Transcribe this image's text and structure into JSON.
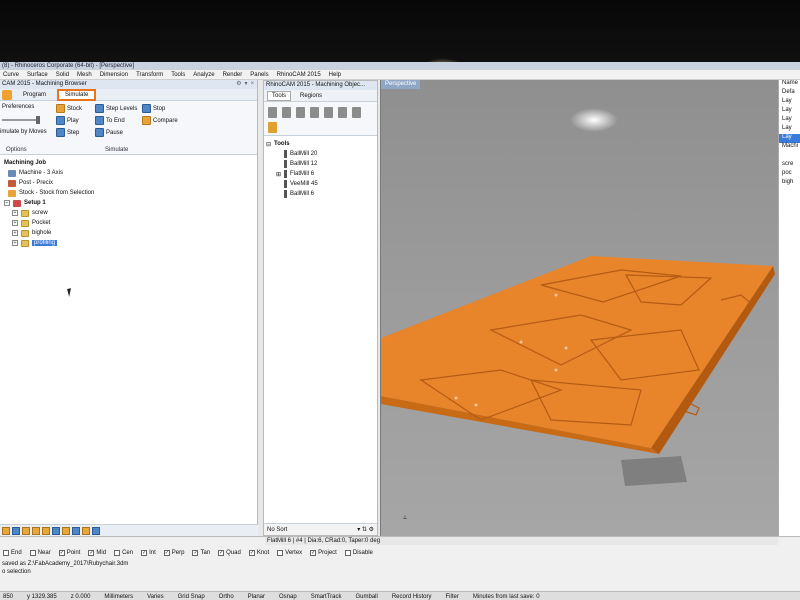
{
  "titlebar": {
    "text": "(8) - Rhinoceros Corporate (64-bit) - [Perspective]"
  },
  "menu": [
    "Curve",
    "Surface",
    "Solid",
    "Mesh",
    "Dimension",
    "Transform",
    "Tools",
    "Analyze",
    "Render",
    "Panels",
    "RhinoCAM 2015",
    "Help"
  ],
  "browser": {
    "title": "CAM 2015 - Machining Browser",
    "tabs": {
      "program": "Program",
      "simulate": "Simulate"
    },
    "ribbon": {
      "preferences": "Preferences",
      "simulate_by_moves": "imulate by Moves",
      "options_group": "Options",
      "simulate_group": "Simulate",
      "stock": "Stock",
      "play": "Play",
      "step": "Step",
      "step_levels": "Step Levels",
      "to_end": "To End",
      "pause": "Pause",
      "stop": "Stop",
      "compare": "Compare"
    },
    "tree": {
      "machining_job": "Machining Job",
      "machine": "Machine - 3 Axis",
      "post": "Post - Precix",
      "stock": "Stock - Stock from Selection",
      "setup": "Setup 1",
      "folders": [
        "screw",
        "Pocket",
        "bighole",
        "profiling"
      ]
    }
  },
  "objects": {
    "title": "RhinoCAM 2015 - Machining Objec...",
    "tabs": {
      "tools": "Tools",
      "regions": "Regions"
    },
    "tree_root": "Tools",
    "tools": [
      "BallMill 20",
      "BallMill 12",
      "FlatMill 6",
      "VeeMill 45",
      "BallMill 6"
    ],
    "sort": "No Sort"
  },
  "viewport": {
    "label": "Perspective",
    "status": "FlatMill 6 | #4 | Dia:6, CRad:0, Taper:0 deg"
  },
  "layers": [
    "Name",
    "Defa",
    "Lay",
    "Lay",
    "Lay",
    "Lay",
    "Lay",
    "Machi",
    "",
    "scre",
    "poc",
    "bigh"
  ],
  "osnap": [
    "End",
    "Near",
    "Point",
    "Mid",
    "Cen",
    "Int",
    "Perp",
    "Tan",
    "Quad",
    "Knot",
    "Vertex",
    "Project",
    "Disable"
  ],
  "osnap_checked": [
    "Point",
    "Mid",
    "Int",
    "Perp",
    "Tan",
    "Quad",
    "Knot",
    "Project"
  ],
  "command": {
    "line1": "saved as Z:\\FabAcademy_2017\\Rubychair.3dm",
    "line2": "o selection"
  },
  "statusbar": {
    "coord": "850",
    "y": "y 1329.385",
    "z": "z 0.000",
    "units": "Millimeters",
    "layer": "Varies",
    "snap": "Grid Snap",
    "ortho": "Ortho",
    "planar": "Planar",
    "osnap_label": "Osnap",
    "smarttrack": "SmartTrack",
    "gumball": "Gumball",
    "record": "Record History",
    "filter": "Filter",
    "minutes": "Minutes from last save: 0"
  }
}
